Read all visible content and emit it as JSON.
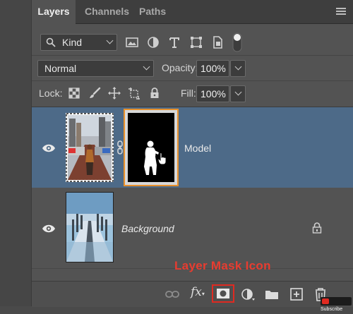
{
  "tabs": [
    {
      "label": "Layers",
      "active": true
    },
    {
      "label": "Channels",
      "active": false
    },
    {
      "label": "Paths",
      "active": false
    }
  ],
  "filter": {
    "kind_label": "Kind",
    "icons": [
      "image-filter-icon",
      "adjustment-filter-icon",
      "type-filter-icon",
      "shape-filter-icon",
      "smart-object-filter-icon",
      "filter-toggle-icon"
    ]
  },
  "blend": {
    "mode": "Normal",
    "opacity_label": "Opacity:",
    "opacity_value": "100%"
  },
  "lock": {
    "label": "Lock:",
    "icons": [
      "lock-transparent-pixels-icon",
      "lock-image-pixels-icon",
      "lock-position-icon",
      "lock-artboard-icon",
      "lock-all-icon"
    ],
    "fill_label": "Fill:",
    "fill_value": "100%"
  },
  "layers": [
    {
      "name": "Model",
      "selected": true,
      "has_mask": true,
      "locked": false
    },
    {
      "name": "Background",
      "selected": false,
      "has_mask": false,
      "locked": true
    }
  ],
  "annotation": {
    "text": "Layer Mask Icon",
    "color": "#e83c30"
  },
  "bottom_toolbar": {
    "icons": [
      "link-layers-icon",
      "fx-icon",
      "add-layer-mask-icon",
      "adjustment-layer-icon",
      "new-group-icon",
      "new-layer-icon",
      "delete-layer-icon"
    ],
    "fx_label": "fx"
  },
  "watermark": {
    "text": "Subscribe"
  },
  "colors": {
    "panel": "#535353",
    "selected_layer": "#4d6a88",
    "mask_border": "#e8902a",
    "highlight": "#e02a21"
  }
}
